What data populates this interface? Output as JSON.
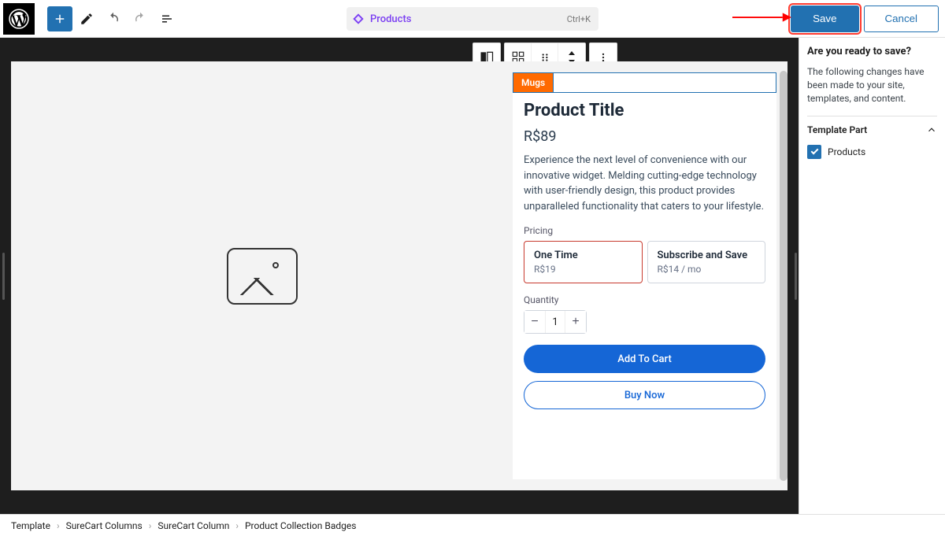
{
  "topbar": {
    "doc_label": "Products",
    "doc_shortcut": "Ctrl+K",
    "save": "Save",
    "cancel": "Cancel"
  },
  "product": {
    "badge": "Mugs",
    "title": "Product Title",
    "price": "R$89",
    "desc": "Experience the next level of convenience with our innovative widget. Melding cutting-edge technology with user-friendly design, this product provides unparalleled functionality that caters to your lifestyle.",
    "pricing_label": "Pricing",
    "quantity_label": "Quantity",
    "quantity_value": "1",
    "options": [
      {
        "title": "One Time",
        "sub": "R$19"
      },
      {
        "title": "Subscribe and Save",
        "sub": "R$14 / mo"
      }
    ],
    "add_to_cart": "Add To Cart",
    "buy_now": "Buy Now"
  },
  "inspector": {
    "heading": "Are you ready to save?",
    "body": "The following changes have been made to your site, templates, and content.",
    "section": "Template Part",
    "item": "Products"
  },
  "crumbs": [
    "Template",
    "SureCart Columns",
    "SureCart Column",
    "Product Collection Badges"
  ]
}
